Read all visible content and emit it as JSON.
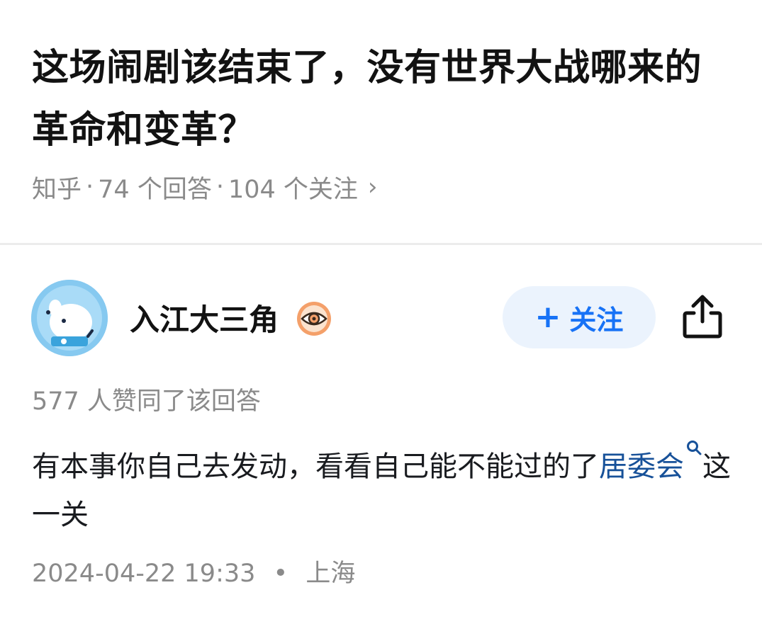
{
  "question": {
    "title": "这场闹剧该结束了，没有世界大战哪来的革命和变革？",
    "source": "知乎",
    "answers": "74 个回答",
    "followers": "104 个关注",
    "separator": "·",
    "chevron": "›"
  },
  "author": {
    "name": "入江大三角",
    "follow_plus": "+",
    "follow_label": "关注",
    "badge_icon": "eye-badge-icon",
    "share_icon": "share-icon"
  },
  "answer": {
    "votes": "577 人赞同了该回答",
    "text_before": "有本事你自己去发动，看看自己能不能过的了",
    "link_text": "居委会",
    "text_after": "这一关",
    "date": "2024-04-22 19:33",
    "dot": "•",
    "location": "上海"
  },
  "colors": {
    "accent": "#1772f6",
    "link": "#175199",
    "muted": "#8a8a8a",
    "follow_bg": "#ebf3fd"
  }
}
